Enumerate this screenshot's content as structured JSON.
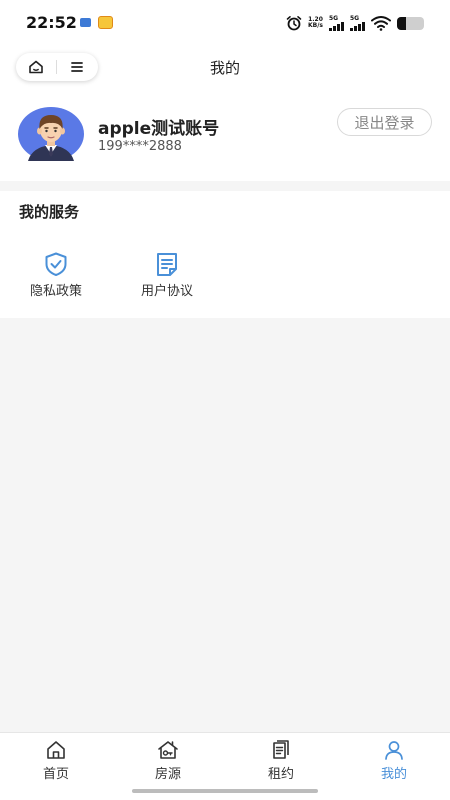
{
  "status_bar": {
    "time": "22:52",
    "net_speed_value": "1.20",
    "net_speed_unit": "KB/s",
    "signal1_label": "5G",
    "signal2_label": "5G"
  },
  "nav": {
    "title": "我的"
  },
  "profile": {
    "username": "apple测试账号",
    "phone": "199****2888",
    "logout_label": "退出登录"
  },
  "services": {
    "title": "我的服务",
    "items": [
      {
        "label": "隐私政策",
        "icon": "shield-check-icon"
      },
      {
        "label": "用户协议",
        "icon": "document-icon"
      }
    ]
  },
  "tabbar": {
    "items": [
      {
        "label": "首页",
        "icon": "home-icon"
      },
      {
        "label": "房源",
        "icon": "house-key-icon"
      },
      {
        "label": "租约",
        "icon": "contract-icon"
      },
      {
        "label": "我的",
        "icon": "user-icon",
        "active": true
      }
    ]
  },
  "colors": {
    "accent": "#4a90d8",
    "avatar_bg": "#5a79e6",
    "page_bg": "#f5f5f5"
  }
}
